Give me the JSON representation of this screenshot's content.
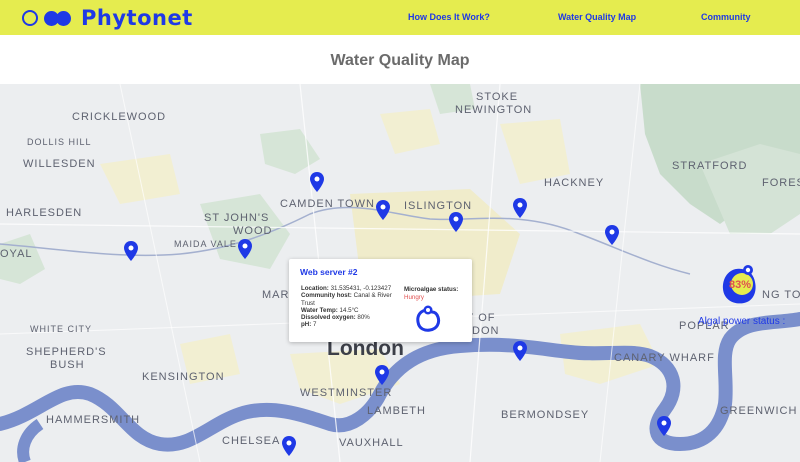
{
  "header": {
    "brand": "Phytonet",
    "nav": [
      "How Does It Work?",
      "Water Quality Map",
      "Community"
    ]
  },
  "page_title": "Water Quality Map",
  "map": {
    "labels": {
      "cricklewood": "CRICKLEWOOD",
      "dollis_hill": "DOLLIS HILL",
      "willesden": "WILLESDEN",
      "harlesden": "HARLESDEN",
      "royal": "OYAL",
      "st_johns": "ST JOHN'S",
      "wood": "WOOD",
      "maida_vale": "MAIDA VALE",
      "camden_town": "CAMDEN TOWN",
      "islington": "ISLINGTON",
      "stoke": "STOKE",
      "newington": "NEWINGTON",
      "hackney": "HACKNEY",
      "stratford": "STRATFORD",
      "forest": "FORES",
      "white_city": "WHITE CITY",
      "shepherds": "SHEPHERD'S",
      "bush": "BUSH",
      "kensington": "KENSINGTON",
      "london": "London",
      "westminster": "WESTMINSTER",
      "lambeth": "LAMBETH",
      "bermondsey": "BERMONDSEY",
      "canary_wharf": "CANARY WHARF",
      "poplar": "POPLAR",
      "greenwich": "GREENWICH",
      "hammersmith": "HAMMERSMITH",
      "chelsea": "CHELSEA",
      "vauxhall": "VAUXHALL",
      "marylebone_frag": "MAR",
      "city_frag1": "Y OF",
      "city_frag2": "DON",
      "ng_frag": "NG TOW"
    },
    "popup": {
      "title": "Web server #2",
      "location_label": "Location:",
      "location_value": "31.535431, -0.123427",
      "host_label": "Community host:",
      "host_value": "Canal & River Trust",
      "temp_label": "Water Temp:",
      "temp_value": "14.5°C",
      "oxygen_label": "Dissolved oxygen:",
      "oxygen_value": "80%",
      "ph_label": "pH:",
      "ph_value": "7",
      "status_label": "Microalgae status:",
      "status_value": "Hungry"
    },
    "algal_power": {
      "percent": "83%",
      "label": "Algal power status :"
    },
    "pin_count": 11
  },
  "colors": {
    "accent": "#1f39e6",
    "header_bg": "#e5ec4f",
    "water": "#7a8fcc",
    "park": "#c8dccb",
    "urban": "#f0eccb",
    "alert": "#e05050"
  }
}
